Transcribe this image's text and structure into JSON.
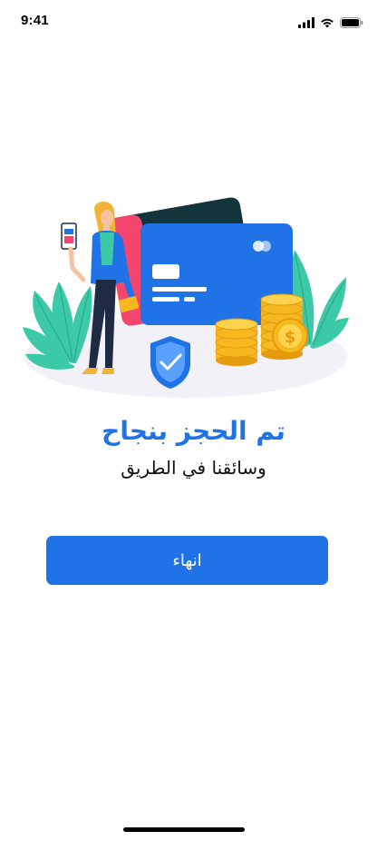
{
  "status_bar": {
    "time": "9:41",
    "icons": [
      "cellular-signal-icon",
      "wifi-icon",
      "battery-icon"
    ]
  },
  "illustration": {
    "name": "booking-success-illustration",
    "elements": [
      "woman-with-phone",
      "credit-cards",
      "shield-check-icon",
      "gold-coins",
      "plants"
    ]
  },
  "content": {
    "title": "تم الحجز بنجاح",
    "subtitle": "وسائقنا في الطريق"
  },
  "actions": {
    "finish_label": "انهاء"
  },
  "colors": {
    "primary": "#1f73e6",
    "card_pink": "#f4456e",
    "card_dark": "#12343b",
    "plant": "#3cc9a8",
    "coin": "#f5b81f",
    "floor": "#f1f1f7"
  }
}
